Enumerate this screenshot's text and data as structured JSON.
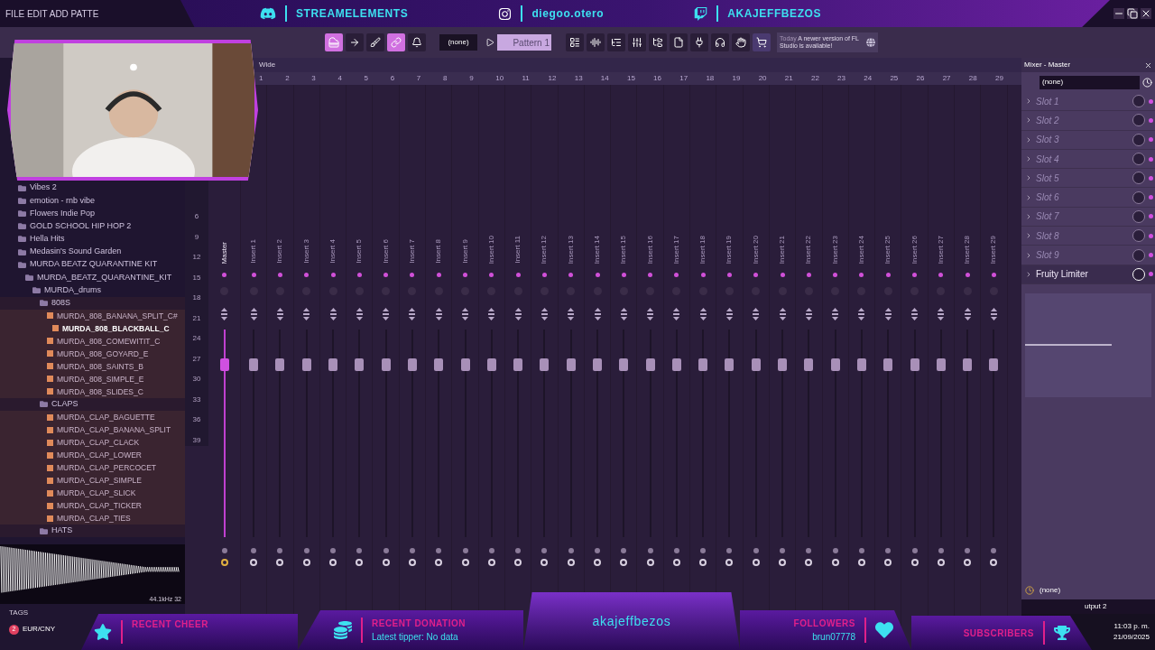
{
  "menu": "FILE EDIT ADD PATTE",
  "socials": [
    {
      "kind": "discord",
      "handle": "STREAMELEMENTS"
    },
    {
      "kind": "instagram",
      "handle": "diegoo.otero"
    },
    {
      "kind": "twitch",
      "handle": "AKAJEFFBEZOS"
    }
  ],
  "toolbar": {
    "pattern_selector": "(none)",
    "pattern": "Pattern 1",
    "news_when": "Today",
    "news_text": "A newer version of FL Studio is available!"
  },
  "browser": {
    "items": [
      {
        "kind": "folder",
        "label": "Vibes 2"
      },
      {
        "kind": "folder",
        "label": "emotion - rnb vibe"
      },
      {
        "kind": "folder",
        "label": "Flowers Indie Pop"
      },
      {
        "kind": "folder",
        "label": "GOLD SCHOOL HIP HOP 2"
      },
      {
        "kind": "folder",
        "label": "Hella Hits"
      },
      {
        "kind": "folder",
        "label": "Medasin's Sound Garden"
      },
      {
        "kind": "folder",
        "label": "MURDA BEATZ QUARANTINE KIT",
        "children": [
          {
            "kind": "folder",
            "label": "MURDA_BEATZ_QUARANTINE_KIT",
            "children": [
              {
                "kind": "folder",
                "label": "MURDA_drums",
                "children": [
                  {
                    "kind": "folder",
                    "label": "808S",
                    "children": [
                      {
                        "kind": "file",
                        "label": "MURDA_808_BANANA_SPLIT_C#",
                        "selected": false
                      },
                      {
                        "kind": "file",
                        "label": "MURDA_808_BLACKBALL_C",
                        "selected": true
                      },
                      {
                        "kind": "file",
                        "label": "MURDA_808_COMEWITIT_C",
                        "selected": false
                      },
                      {
                        "kind": "file",
                        "label": "MURDA_808_GOYARD_E",
                        "selected": false
                      },
                      {
                        "kind": "file",
                        "label": "MURDA_808_SAINTS_B",
                        "selected": false
                      },
                      {
                        "kind": "file",
                        "label": "MURDA_808_SIMPLE_E",
                        "selected": false
                      },
                      {
                        "kind": "file",
                        "label": "MURDA_808_SLIDES_C",
                        "selected": false
                      }
                    ]
                  },
                  {
                    "kind": "folder",
                    "label": "CLAPS",
                    "children": [
                      {
                        "kind": "file",
                        "label": "MURDA_CLAP_BAGUETTE",
                        "selected": false
                      },
                      {
                        "kind": "file",
                        "label": "MURDA_CLAP_BANANA_SPLIT",
                        "selected": false
                      },
                      {
                        "kind": "file",
                        "label": "MURDA_CLAP_CLACK",
                        "selected": false
                      },
                      {
                        "kind": "file",
                        "label": "MURDA_CLAP_LOWER",
                        "selected": false
                      },
                      {
                        "kind": "file",
                        "label": "MURDA_CLAP_PERCOCET",
                        "selected": false
                      },
                      {
                        "kind": "file",
                        "label": "MURDA_CLAP_SIMPLE",
                        "selected": false
                      },
                      {
                        "kind": "file",
                        "label": "MURDA_CLAP_SLICK",
                        "selected": false
                      },
                      {
                        "kind": "file",
                        "label": "MURDA_CLAP_TICKER",
                        "selected": false
                      },
                      {
                        "kind": "file",
                        "label": "MURDA_CLAP_TIES",
                        "selected": false
                      }
                    ]
                  },
                  {
                    "kind": "folder",
                    "label": "HATS"
                  }
                ]
              }
            ]
          }
        ]
      }
    ]
  },
  "sample_info": "44.1kHz 32",
  "tags": "TAGS",
  "ticker": {
    "symbol": "EUR/CNY",
    "badge": "2"
  },
  "mixer": {
    "mode": "Wide",
    "ruler": [
      "1",
      "2",
      "3",
      "4",
      "5",
      "6",
      "7",
      "8",
      "9",
      "10",
      "11",
      "12",
      "13",
      "14",
      "15",
      "16",
      "17",
      "18",
      "19",
      "20",
      "21",
      "22",
      "23",
      "24",
      "25",
      "26",
      "27",
      "28",
      "29"
    ],
    "scale": [
      "6",
      "9",
      "12",
      "15",
      "18",
      "21",
      "24",
      "27",
      "30",
      "33",
      "36",
      "39"
    ],
    "tracks": [
      {
        "name": "Master",
        "level": 0.83,
        "selected": true
      },
      {
        "name": "Insert 1",
        "level": 0.83,
        "selected": false
      },
      {
        "name": "Insert 2",
        "level": 0.83,
        "selected": false
      },
      {
        "name": "Insert 3",
        "level": 0.83,
        "selected": false
      },
      {
        "name": "Insert 4",
        "level": 0.83,
        "selected": false
      },
      {
        "name": "Insert 5",
        "level": 0.83,
        "selected": false
      },
      {
        "name": "Insert 6",
        "level": 0.83,
        "selected": false
      },
      {
        "name": "Insert 7",
        "level": 0.83,
        "selected": false
      },
      {
        "name": "Insert 8",
        "level": 0.83,
        "selected": false
      },
      {
        "name": "Insert 9",
        "level": 0.83,
        "selected": false
      },
      {
        "name": "Insert 10",
        "level": 0.83,
        "selected": false
      },
      {
        "name": "Insert 11",
        "level": 0.83,
        "selected": false
      },
      {
        "name": "Insert 12",
        "level": 0.83,
        "selected": false
      },
      {
        "name": "Insert 13",
        "level": 0.83,
        "selected": false
      },
      {
        "name": "Insert 14",
        "level": 0.83,
        "selected": false
      },
      {
        "name": "Insert 15",
        "level": 0.83,
        "selected": false
      },
      {
        "name": "Insert 16",
        "level": 0.83,
        "selected": false
      },
      {
        "name": "Insert 17",
        "level": 0.83,
        "selected": false
      },
      {
        "name": "Insert 18",
        "level": 0.83,
        "selected": false
      },
      {
        "name": "Insert 19",
        "level": 0.83,
        "selected": false
      },
      {
        "name": "Insert 20",
        "level": 0.83,
        "selected": false
      },
      {
        "name": "Insert 21",
        "level": 0.83,
        "selected": false
      },
      {
        "name": "Insert 22",
        "level": 0.83,
        "selected": false
      },
      {
        "name": "Insert 23",
        "level": 0.83,
        "selected": false
      },
      {
        "name": "Insert 24",
        "level": 0.83,
        "selected": false
      },
      {
        "name": "Insert 25",
        "level": 0.83,
        "selected": false
      },
      {
        "name": "Insert 26",
        "level": 0.83,
        "selected": false
      },
      {
        "name": "Insert 27",
        "level": 0.83,
        "selected": false
      },
      {
        "name": "Insert 28",
        "level": 0.83,
        "selected": false
      },
      {
        "name": "Insert 29",
        "level": 0.83,
        "selected": false
      }
    ]
  },
  "master_panel": {
    "title": "Mixer - Master",
    "input": "(none)",
    "slots": [
      {
        "name": "Slot 1",
        "empty": true
      },
      {
        "name": "Slot 2",
        "empty": true
      },
      {
        "name": "Slot 3",
        "empty": true
      },
      {
        "name": "Slot 4",
        "empty": true
      },
      {
        "name": "Slot 5",
        "empty": true
      },
      {
        "name": "Slot 6",
        "empty": true
      },
      {
        "name": "Slot 7",
        "empty": true
      },
      {
        "name": "Slot 8",
        "empty": true
      },
      {
        "name": "Slot 9",
        "empty": true
      },
      {
        "name": "Fruity Limiter",
        "empty": false
      }
    ],
    "output_source": "(none)",
    "output": "utput 2"
  },
  "overlay": {
    "cheer_label": "RECENT CHEER",
    "donation_label": "RECENT DONATION",
    "donation_value": "Latest tipper: No data",
    "channel": "akajeffbezos",
    "followers_label": "FOLLOWERS",
    "followers_value": "brun07778",
    "subscribers_label": "SUBSCRIBERS"
  },
  "clock": {
    "time": "11:03 p. m.",
    "date": "21/09/2025"
  }
}
